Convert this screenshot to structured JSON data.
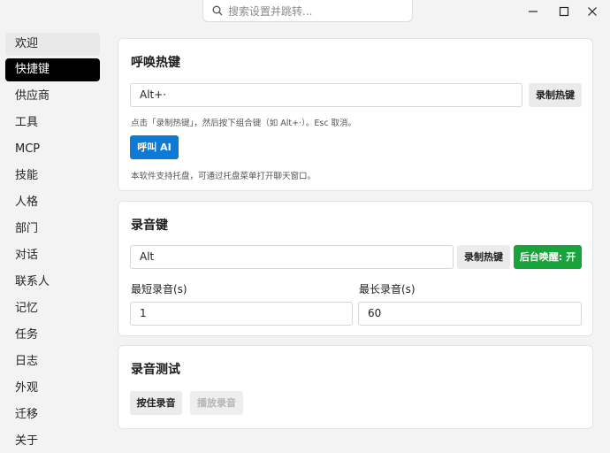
{
  "titlebar": {
    "search_placeholder": "搜索设置并跳转..."
  },
  "sidebar": {
    "items": [
      {
        "label": "欢迎"
      },
      {
        "label": "快捷键"
      },
      {
        "label": "供应商"
      },
      {
        "label": "工具"
      },
      {
        "label": "MCP"
      },
      {
        "label": "技能"
      },
      {
        "label": "人格"
      },
      {
        "label": "部门"
      },
      {
        "label": "对话"
      },
      {
        "label": "联系人"
      },
      {
        "label": "记忆"
      },
      {
        "label": "任务"
      },
      {
        "label": "日志"
      },
      {
        "label": "外观"
      },
      {
        "label": "迁移"
      },
      {
        "label": "关于"
      }
    ],
    "active_index": 1
  },
  "wake_card": {
    "title": "呼唤热键",
    "hotkey_value": "Alt+·",
    "record_button": "录制热键",
    "hint": "点击「录制热键」，然后按下组合键（如 Alt+·）。Esc 取消。",
    "call_button": "呼叫 AI",
    "tray_hint": "本软件支持托盘，可通过托盘菜单打开聊天窗口。"
  },
  "record_card": {
    "title": "录音键",
    "hotkey_value": "Alt",
    "record_button": "录制热键",
    "background_wake_button": "后台唤醒: 开",
    "min_label": "最短录音(s)",
    "min_value": "1",
    "max_label": "最长录音(s)",
    "max_value": "60"
  },
  "test_card": {
    "title": "录音测试",
    "hold_button": "按住录音",
    "play_button": "播放录音"
  },
  "colors": {
    "accent_blue": "#0d7ad6",
    "accent_green": "#1aa33a",
    "active_item": "#000000"
  }
}
